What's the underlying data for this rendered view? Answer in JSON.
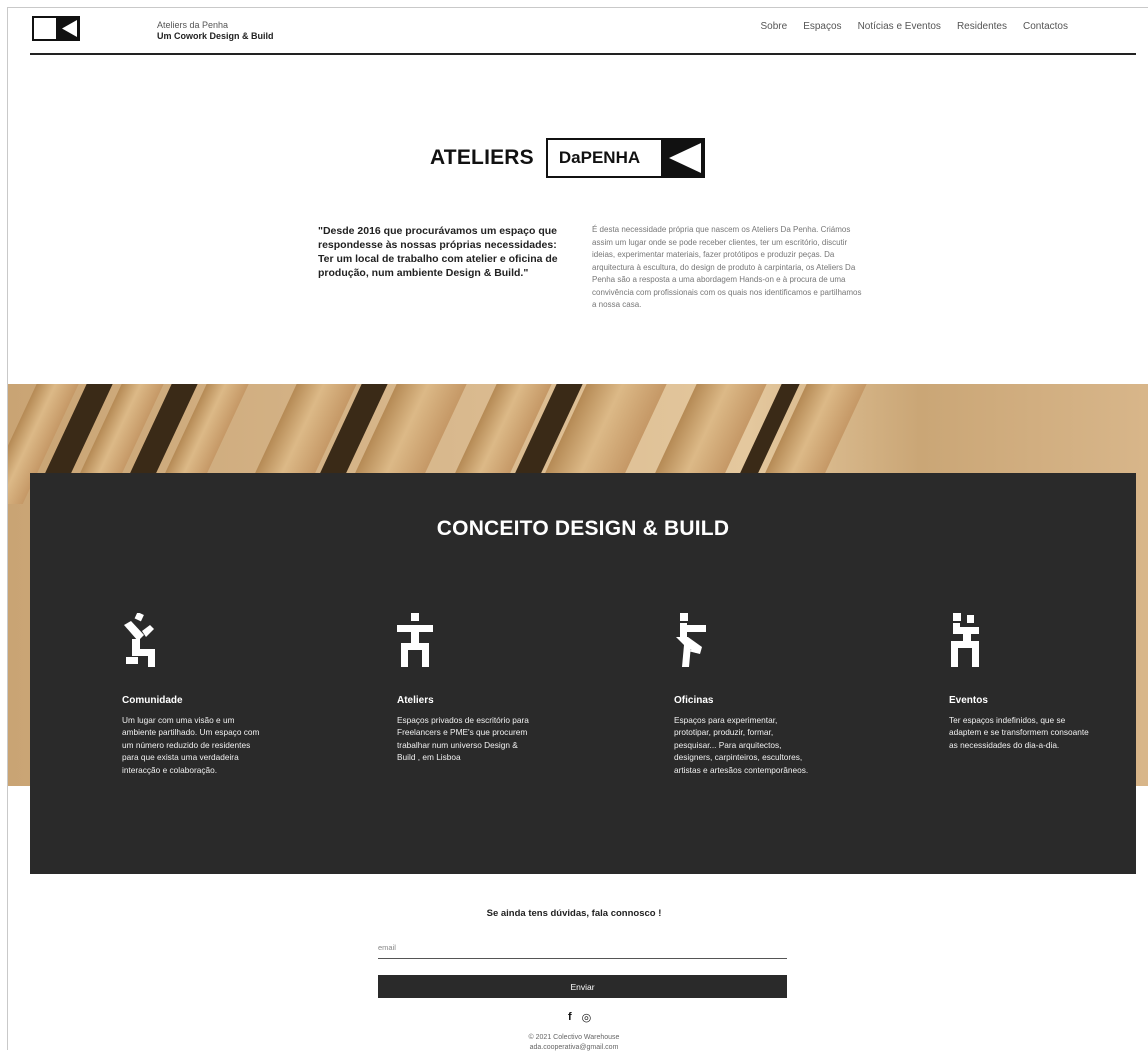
{
  "header": {
    "brand_top": "Ateliers da Penha",
    "brand_sub": "Um Cowork Design & Build",
    "nav": [
      "Sobre",
      "Espaços",
      "Notícias e Eventos",
      "Residentes",
      "Contactos"
    ]
  },
  "title": {
    "word": "ATELIERS",
    "box": "DaPENHA"
  },
  "intro": {
    "quote": "\"Desde 2016 que procurávamos um espaço que respondesse às nossas próprias necessidades: Ter um local de trabalho com atelier e oficina de produção, num ambiente Design & Build.\"",
    "text": "É desta necessidade própria que nascem os Ateliers Da Penha. Criámos assim um lugar onde se pode receber clientes, ter um escritório, discutir ideias, experimentar materiais, fazer protótipos e produzir peças. Da arquitectura à escultura, do design de produto à carpintaria, os Ateliers Da Penha são a resposta a uma abordagem Hands-on e à procura de uma convivência com profissionais com os quais nos identificamos e partilhamos a nossa casa."
  },
  "concept": {
    "title": "CONCEITO DESIGN & BUILD",
    "features": [
      {
        "icon": "figure-community-icon",
        "title": "Comunidade",
        "text": "Um lugar com uma visão e um ambiente partilhado. Um espaço com um número reduzido de residentes para que exista uma verdadeira interacção e colaboração."
      },
      {
        "icon": "figure-ateliers-icon",
        "title": "Ateliers",
        "text": "Espaços privados de escritório para Freelancers e PME's que procurem trabalhar num universo Design & Build , em Lisboa"
      },
      {
        "icon": "figure-oficinas-icon",
        "title": "Oficinas",
        "text": "Espaços para experimentar, prototipar, produzir, formar, pesquisar... Para arquitectos, designers, carpinteiros, escultores, artistas e artesãos contemporâneos."
      },
      {
        "icon": "figure-eventos-icon",
        "title": "Eventos",
        "text": "Ter espaços indefinidos, que se adaptem e se transformem consoante as necessidades do dia-a-dia."
      }
    ]
  },
  "contact": {
    "title": "Se ainda tens dúvidas, fala connosco !",
    "email_placeholder": "email",
    "submit_label": "Enviar"
  },
  "social": {
    "facebook": "f",
    "instagram": "◎"
  },
  "footer": {
    "line1": "© 2021 Colectivo Warehouse",
    "line2": "ada.cooperativa@gmail.com"
  },
  "colors": {
    "dark_panel": "#2a2a2a",
    "text": "#222222",
    "muted": "#777777"
  }
}
